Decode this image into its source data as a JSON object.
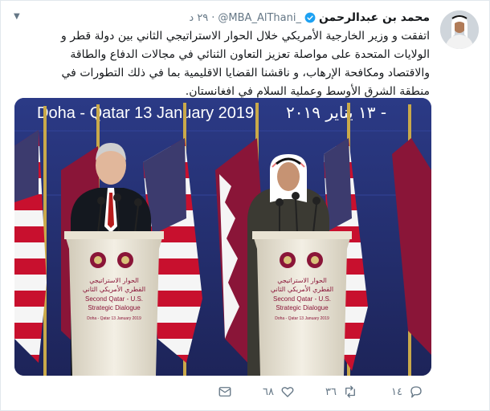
{
  "tweet": {
    "author_name": "محمد بن عبدالرحمن",
    "handle": "@MBA_AlThani_",
    "time": "٢٩ د",
    "text": "اتفقت و وزير الخارجية الأمريكي خلال الحوار الاستراتيجي الثاني بين دولة قطر و الولايات المتحدة على مواصلة تعزيز التعاون الثنائي في مجالات الدفاع والطاقة والاقتصاد ومكافحة الإرهاب، و ناقشنا القضايا الاقليمية بما في ذلك التطورات في منطقة الشرق الأوسط وعملية السلام في افغانستان."
  },
  "media": {
    "banner_en": "Doha - Qatar 13 January 2019",
    "banner_ar": "١٣ يناير ٢٠١٩ -",
    "podium_ar_1": "الحوار الاستراتيجي",
    "podium_ar_2": "القطري الأمريكي الثاني",
    "podium_en_1": "Second Qatar - U.S.",
    "podium_en_2": "Strategic Dialogue",
    "podium_date": "Doha - Qatar 13 January 2019"
  },
  "actions": {
    "reply_count": "١٤",
    "retweet_count": "٣٦",
    "like_count": "٦٨"
  },
  "colors": {
    "flag_maroon": "#8a1538",
    "flag_red": "#c8102e",
    "flag_blue": "#3c3b6e",
    "verified_blue": "#1da1f2"
  }
}
